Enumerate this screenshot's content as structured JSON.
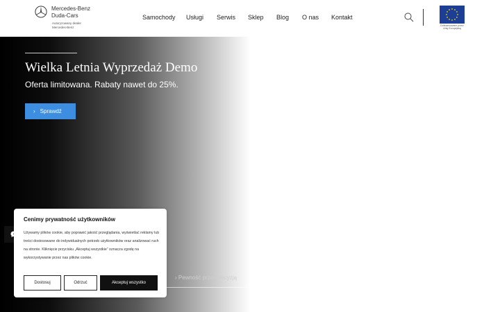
{
  "brand": {
    "name_line1": "Mercedes-Benz",
    "name_line2": "Duda-Cars",
    "sub_line1": "Autoryzowany dealer",
    "sub_line2": "Mercedes-Benz"
  },
  "nav": {
    "items": [
      {
        "label": "Samochody"
      },
      {
        "label": "Usługi"
      },
      {
        "label": "Serwis"
      },
      {
        "label": "Sklep"
      },
      {
        "label": "Blog"
      },
      {
        "label": "O nas"
      },
      {
        "label": "Kontakt"
      }
    ]
  },
  "eu": {
    "text_line1": "Dofinansowane przez",
    "text_line2": "Unię Europejską"
  },
  "hero": {
    "title": "Wielka Letnia Wyprzedaż Demo",
    "subtitle": "Oferta limitowana. Rabaty nawet do 25%.",
    "cta_label": "Sprawdź",
    "slide_label": "Pewność przed decyzją"
  },
  "cookie": {
    "title": "Cenimy prywatność użytkowników",
    "text": "Używamy plików cookie, aby poprawić jakość przeglądania, wyświetlać reklamy lub treści dostosowane do indywidualnych potrzeb użytkowników oraz analizować ruch na stronie. Kliknięcie przycisku „Akceptuj wszystkie” oznacza zgodę na wykorzystywanie przez nas plików cookie.",
    "btn_customize": "Dostosuj",
    "btn_reject": "Odrzuć",
    "btn_accept": "Akceptuj wszystko"
  },
  "icons": {
    "logo": "mercedes-star-icon",
    "search": "search-icon",
    "chat": "chat-icon",
    "chevron": "chevron-right-icon"
  },
  "colors": {
    "cta": "#3d8ee0",
    "eu_flag": "#1c3f95",
    "eu_stars": "#ffd700"
  }
}
